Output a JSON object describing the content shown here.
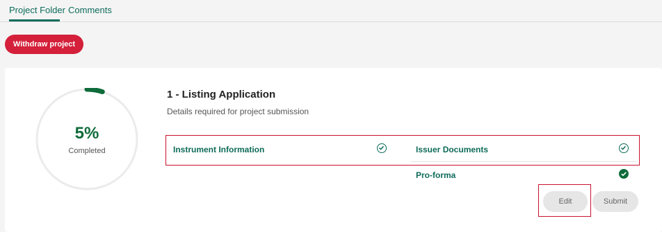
{
  "tabs": {
    "project_folder": "Project Folder",
    "comments": "Comments"
  },
  "actions": {
    "withdraw": "Withdraw project"
  },
  "progress": {
    "percent_text": "5%",
    "percent_value": 5,
    "label": "Completed"
  },
  "section": {
    "title": "1 - Listing Application",
    "subtitle": "Details required for project submission"
  },
  "items": {
    "instrument_information": "Instrument Information",
    "issuer_documents": "Issuer Documents",
    "pro_forma": "Pro-forma"
  },
  "buttons": {
    "edit": "Edit",
    "submit": "Submit"
  },
  "colors": {
    "accent_teal": "#0e6b5a",
    "brand_red": "#d4203a",
    "progress_green": "#0e6b3a"
  }
}
